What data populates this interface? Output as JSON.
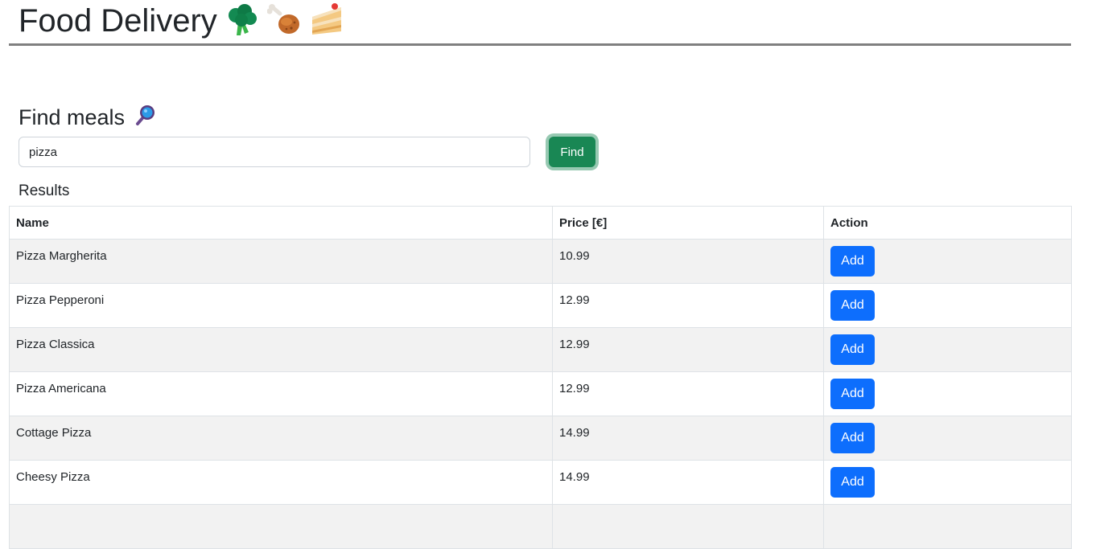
{
  "header": {
    "title": "Food Delivery",
    "icons": [
      "broccoli-icon",
      "poultry-leg-icon",
      "cake-slice-icon"
    ]
  },
  "search": {
    "title": "Find meals",
    "title_icon": "magnifying-glass-icon",
    "value": "pizza",
    "button_label": "Find"
  },
  "results": {
    "label": "Results",
    "columns": [
      "Name",
      "Price [€]",
      "Action"
    ],
    "rows": [
      {
        "name": "Pizza Margherita",
        "price": "10.99",
        "action": "Add"
      },
      {
        "name": "Pizza Pepperoni",
        "price": "12.99",
        "action": "Add"
      },
      {
        "name": "Pizza Classica",
        "price": "12.99",
        "action": "Add"
      },
      {
        "name": "Pizza Americana",
        "price": "12.99",
        "action": "Add"
      },
      {
        "name": "Cottage Pizza",
        "price": "14.99",
        "action": "Add"
      },
      {
        "name": "Cheesy Pizza",
        "price": "14.99",
        "action": "Add"
      },
      {
        "name": "",
        "price": "",
        "action": ""
      }
    ]
  },
  "colors": {
    "find_button": "#198754",
    "add_button": "#0d6efd",
    "header_rule": "#808080",
    "striped_row": "#f2f2f2"
  }
}
